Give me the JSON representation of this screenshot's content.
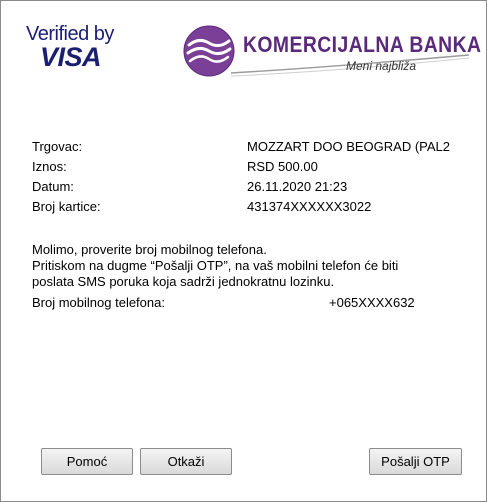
{
  "logos": {
    "verified_by": "Verified by",
    "visa": "VISA",
    "bank_name": "KOMERCIJALNA BANKA",
    "bank_tagline": "Meni najbliža",
    "bank_color": "#5a2a7a"
  },
  "transaction": {
    "merchant_label": "Trgovac:",
    "merchant_value": "MOZZART DOO BEOGRAD (PAL2",
    "amount_label": "Iznos:",
    "amount_value": "RSD 500.00",
    "date_label": "Datum:",
    "date_value": "26.11.2020 21:23",
    "card_label": "Broj kartice:",
    "card_value": "431374XXXXXX3022"
  },
  "message": {
    "line1": "Molimo, proverite broj mobilnog telefona.",
    "line2": "Pritiskom na dugme “Pošalji OTP”, na vaš mobilni telefon će biti",
    "line3": "poslata SMS poruka koja sadrži jednokratnu lozinku.",
    "phone_label": "Broj mobilnog telefona:",
    "phone_value": "+065XXXX632"
  },
  "buttons": {
    "help": "Pomoć",
    "cancel": "Otkaži",
    "send_otp": "Pošalji OTP"
  }
}
